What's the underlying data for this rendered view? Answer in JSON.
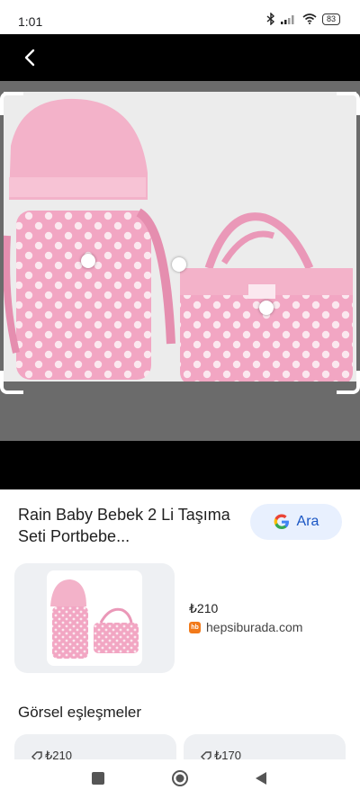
{
  "status": {
    "time": "1:01",
    "battery": "83"
  },
  "product": {
    "title": "Rain Baby Bebek 2 Li Taşıma Seti Portbebe...",
    "search_button": "Ara",
    "price": "₺210",
    "source": "hepsiburada.com",
    "source_badge": "hb"
  },
  "matches": {
    "heading": "Görsel eşleşmeler",
    "items": [
      {
        "price": "₺210"
      },
      {
        "price": "₺170"
      }
    ]
  },
  "colors": {
    "accent": "#1a56c4",
    "chip": "#e8f0fe",
    "product_pink": "#f0a3c1",
    "hb_orange": "#f27a1a"
  },
  "icons": [
    "back-arrow-icon",
    "bluetooth-icon",
    "signal-icon",
    "wifi-icon",
    "battery-icon",
    "google-icon",
    "tag-icon",
    "square-nav-icon",
    "home-nav-icon",
    "back-nav-icon"
  ]
}
